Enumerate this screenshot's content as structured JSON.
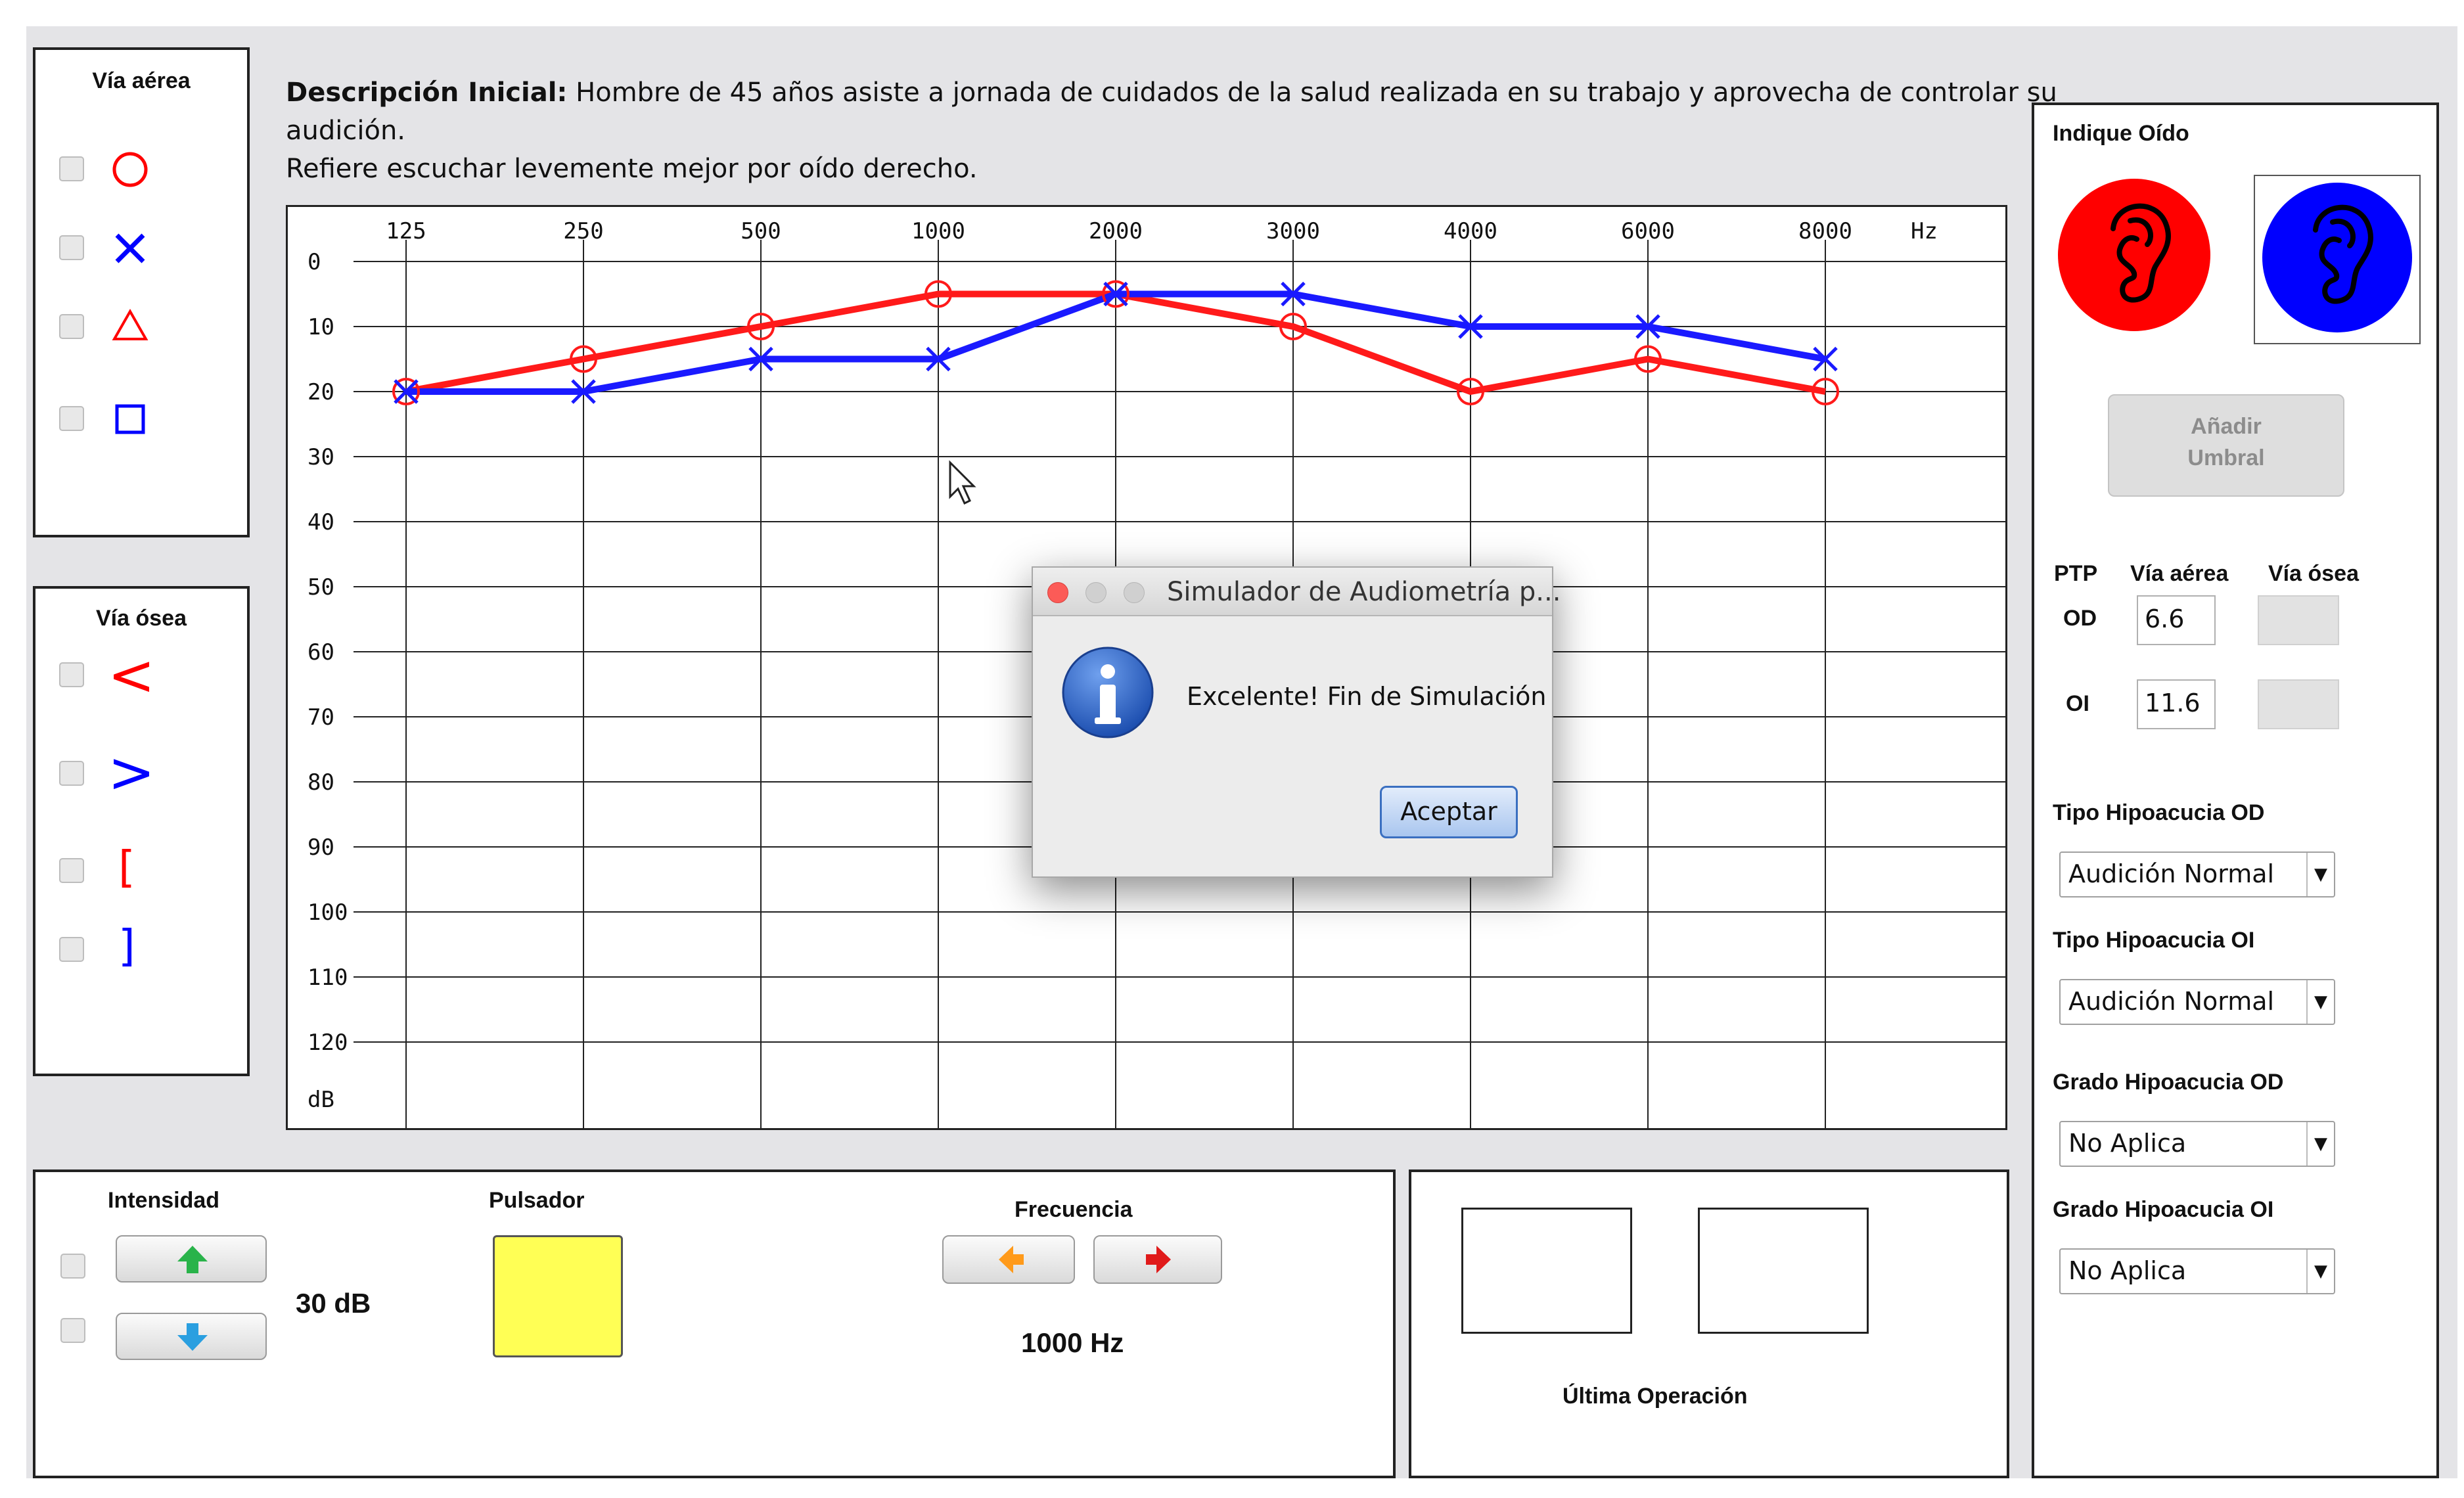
{
  "description": {
    "label": "Descripción Inicial:",
    "text": " Hombre de 45 años asiste a jornada de cuidados de la salud realizada en su trabajo y aprovecha de controlar su audición.",
    "text2": "Refiere escuchar levemente mejor por oído derecho."
  },
  "via_aerea": {
    "title": "Vía aérea"
  },
  "via_osea": {
    "title": "Vía ósea"
  },
  "symbols": {
    "lt": "<",
    "gt": ">",
    "lbr": "[",
    "rbr": "]"
  },
  "audiogram": {
    "frequencies": [
      "125",
      "250",
      "500",
      "1000",
      "2000",
      "3000",
      "4000",
      "6000",
      "8000"
    ],
    "freq_unit": "Hz",
    "db_ticks": [
      "0",
      "10",
      "20",
      "30",
      "40",
      "50",
      "60",
      "70",
      "80",
      "90",
      "100",
      "110",
      "120"
    ],
    "db_unit": "dB"
  },
  "chart_data": {
    "type": "line",
    "categories": [
      "125",
      "250",
      "500",
      "1000",
      "2000",
      "3000",
      "4000",
      "6000",
      "8000"
    ],
    "xlabel": "Hz",
    "ylabel": "dB",
    "ylim": [
      0,
      120
    ],
    "y_inverted": true,
    "grid": true,
    "series": [
      {
        "name": "",
        "color": "#ff1a1a",
        "marker": "circle",
        "values": [
          20,
          15,
          10,
          5,
          5,
          10,
          20,
          15,
          20
        ]
      },
      {
        "name": "",
        "color": "#1a1aff",
        "marker": "x",
        "values": [
          20,
          20,
          15,
          15,
          5,
          5,
          10,
          10,
          15
        ]
      }
    ]
  },
  "dialog": {
    "title": "Simulador de Audiometría p...",
    "message": "Excelente! Fin de Simulación",
    "ok_label": "Aceptar"
  },
  "intensity": {
    "title": "Intensidad",
    "value": "30 dB"
  },
  "pulsador": {
    "title": "Pulsador",
    "color": "#ffff55"
  },
  "frequency": {
    "title": "Frecuencia",
    "value": "1000 Hz"
  },
  "last_op": {
    "title": "Última Operación"
  },
  "right_panel": {
    "ear_title": "Indique Oído",
    "add_threshold_line1": "Añadir",
    "add_threshold_line2": "Umbral",
    "ptp": "PTP",
    "via_aerea": "Vía aérea",
    "via_osea": "Vía ósea",
    "od": "OD",
    "oi": "OI",
    "od_value": "6.6",
    "oi_value": "11.6",
    "tipo_od_label": "Tipo Hipoacucia OD",
    "tipo_od_value": "Audición Normal",
    "tipo_oi_label": "Tipo Hipoacucia OI",
    "tipo_oi_value": "Audición Normal",
    "grado_od_label": "Grado Hipoacucia OD",
    "grado_od_value": "No Aplica",
    "grado_oi_label": "Grado Hipoacucia OI",
    "grado_oi_value": "No Aplica"
  },
  "colors": {
    "right_ear": "#ff0000",
    "left_ear": "#0000ff",
    "accent_blue": "#2a5db0"
  }
}
